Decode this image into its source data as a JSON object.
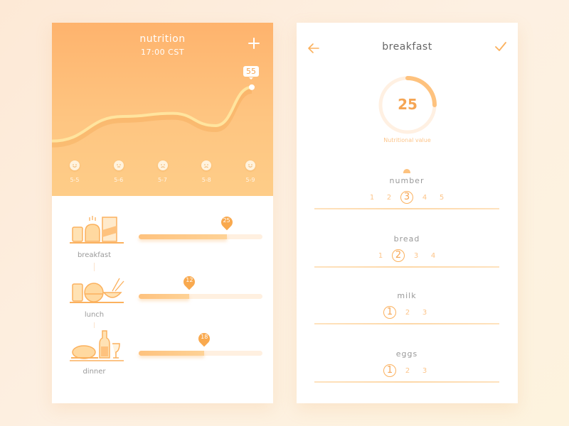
{
  "colors": {
    "accent": "#f9a94e",
    "header_top": "#feb36d",
    "header_bottom": "#fecd88",
    "label_gray": "#9a9a9a"
  },
  "left": {
    "title": "nutrition",
    "time": "17:00 CST",
    "add_icon": "plus-icon",
    "chart_data": {
      "type": "line",
      "title": "nutrition",
      "x": [
        "5-5",
        "5-6",
        "5-7",
        "5-8",
        "5-9"
      ],
      "values": [
        20,
        36,
        38,
        30,
        55
      ],
      "peak_label": "55",
      "ylim": [
        0,
        60
      ]
    },
    "days": [
      {
        "label": "5-5",
        "mood": "happy"
      },
      {
        "label": "5-6",
        "mood": "neutral"
      },
      {
        "label": "5-7",
        "mood": "sad"
      },
      {
        "label": "5-8",
        "mood": "sad"
      },
      {
        "label": "5-9",
        "mood": "happy"
      }
    ],
    "meals": [
      {
        "label": "breakfast",
        "value": "25",
        "fraction": 0.71,
        "icon": "breakfast-icon"
      },
      {
        "label": "lunch",
        "value": "12",
        "fraction": 0.41,
        "icon": "lunch-icon"
      },
      {
        "label": "dinner",
        "value": "18",
        "fraction": 0.53,
        "icon": "dinner-icon"
      }
    ]
  },
  "right": {
    "title": "breakfast",
    "back_icon": "arrow-left-icon",
    "confirm_icon": "check-icon",
    "nutritional_value": "25",
    "nutritional_fraction": 0.25,
    "nutritional_caption": "Nutritional value",
    "sections": [
      {
        "label": "number",
        "options": [
          "1",
          "2",
          "3",
          "4",
          "5"
        ],
        "selected": "3"
      },
      {
        "label": "bread",
        "options": [
          "1",
          "2",
          "3",
          "4"
        ],
        "selected": "2"
      },
      {
        "label": "milk",
        "options": [
          "1",
          "2",
          "3"
        ],
        "selected": "1"
      },
      {
        "label": "eggs",
        "options": [
          "1",
          "2",
          "3"
        ],
        "selected": "1"
      }
    ]
  }
}
